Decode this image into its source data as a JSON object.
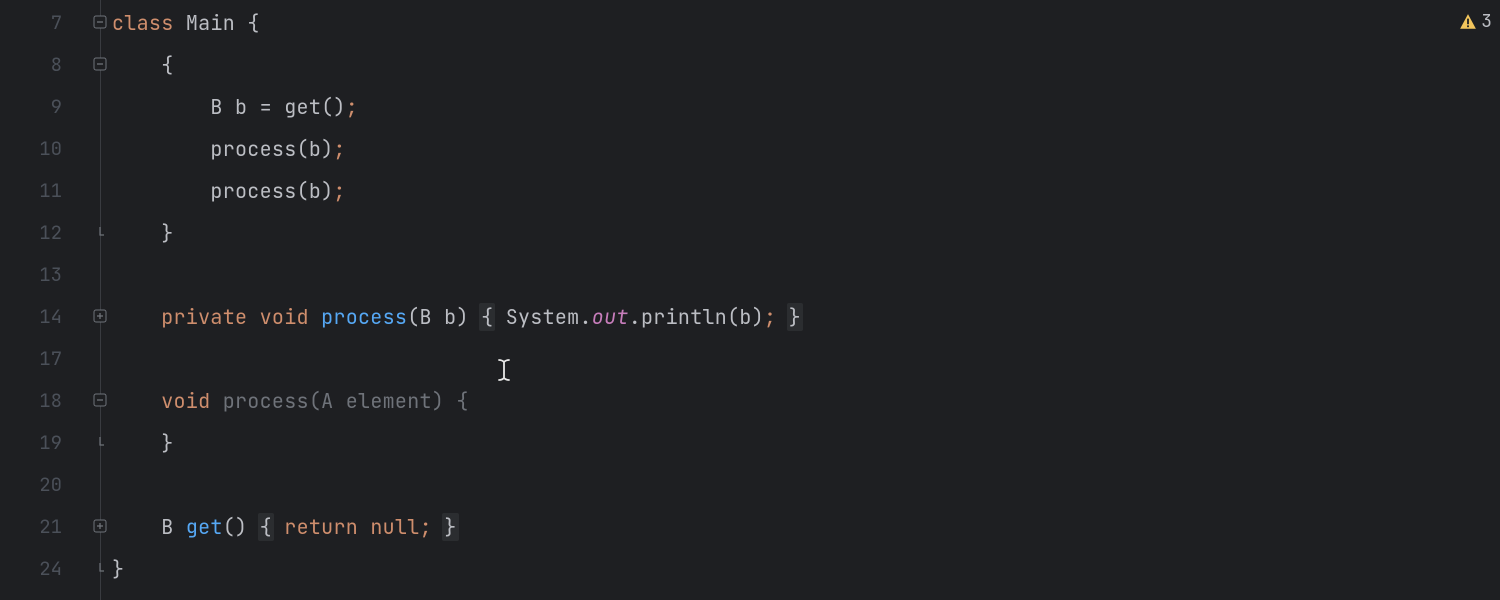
{
  "warningCount": "3",
  "lines": [
    {
      "num": "7",
      "fold": "minus-top",
      "tokens": [
        {
          "t": "class ",
          "c": "kw"
        },
        {
          "t": "Main ",
          "c": "name"
        },
        {
          "t": "{",
          "c": "paren"
        }
      ]
    },
    {
      "num": "8",
      "fold": "minus",
      "tokens": [
        {
          "t": "    {",
          "c": "paren"
        }
      ]
    },
    {
      "num": "9",
      "fold": "line",
      "tokens": [
        {
          "t": "        ",
          "c": ""
        },
        {
          "t": "B b ",
          "c": "name"
        },
        {
          "t": "= ",
          "c": "name"
        },
        {
          "t": "get",
          "c": "fn-call"
        },
        {
          "t": "()",
          "c": "paren"
        },
        {
          "t": ";",
          "c": "semi"
        }
      ]
    },
    {
      "num": "10",
      "fold": "line",
      "tokens": [
        {
          "t": "        ",
          "c": ""
        },
        {
          "t": "process",
          "c": "fn-call"
        },
        {
          "t": "(b)",
          "c": "paren"
        },
        {
          "t": ";",
          "c": "semi"
        }
      ]
    },
    {
      "num": "11",
      "fold": "line",
      "tokens": [
        {
          "t": "        ",
          "c": ""
        },
        {
          "t": "process",
          "c": "fn-call"
        },
        {
          "t": "(b)",
          "c": "paren"
        },
        {
          "t": ";",
          "c": "semi"
        }
      ]
    },
    {
      "num": "12",
      "fold": "close",
      "tokens": [
        {
          "t": "    }",
          "c": "paren"
        }
      ]
    },
    {
      "num": "13",
      "fold": "line",
      "tokens": []
    },
    {
      "num": "14",
      "fold": "plus",
      "tokens": [
        {
          "t": "    ",
          "c": ""
        },
        {
          "t": "private void ",
          "c": "kw"
        },
        {
          "t": "process",
          "c": "fn-def"
        },
        {
          "t": "(",
          "c": "paren"
        },
        {
          "t": "B b",
          "c": "param"
        },
        {
          "t": ")",
          "c": "paren"
        },
        {
          "t": " ",
          "c": ""
        },
        {
          "t": "{",
          "c": "paren",
          "hl": true
        },
        {
          "t": " ",
          "c": ""
        },
        {
          "t": "System.",
          "c": "name"
        },
        {
          "t": "out",
          "c": "static-field"
        },
        {
          "t": ".println(b)",
          "c": "name"
        },
        {
          "t": ";",
          "c": "semi"
        },
        {
          "t": " ",
          "c": ""
        },
        {
          "t": "}",
          "c": "paren",
          "hl": true
        }
      ]
    },
    {
      "num": "17",
      "fold": "line",
      "tokens": []
    },
    {
      "num": "18",
      "fold": "minus",
      "tokens": [
        {
          "t": "    ",
          "c": ""
        },
        {
          "t": "void ",
          "c": "kw"
        },
        {
          "t": "process",
          "c": "dim"
        },
        {
          "t": "(",
          "c": "dim"
        },
        {
          "t": "A element",
          "c": "dim"
        },
        {
          "t": ") {",
          "c": "dim"
        }
      ]
    },
    {
      "num": "19",
      "fold": "close",
      "tokens": [
        {
          "t": "    }",
          "c": "paren"
        }
      ]
    },
    {
      "num": "20",
      "fold": "line",
      "tokens": []
    },
    {
      "num": "21",
      "fold": "plus",
      "tokens": [
        {
          "t": "    ",
          "c": ""
        },
        {
          "t": "B ",
          "c": "type"
        },
        {
          "t": "get",
          "c": "fn-def"
        },
        {
          "t": "()",
          "c": "paren"
        },
        {
          "t": " ",
          "c": ""
        },
        {
          "t": "{",
          "c": "paren",
          "hl": true
        },
        {
          "t": " ",
          "c": ""
        },
        {
          "t": "return null",
          "c": "kw"
        },
        {
          "t": ";",
          "c": "semi"
        },
        {
          "t": " ",
          "c": ""
        },
        {
          "t": "}",
          "c": "paren",
          "hl": true
        }
      ]
    },
    {
      "num": "24",
      "fold": "close",
      "tokens": [
        {
          "t": "}",
          "c": "paren"
        }
      ]
    }
  ]
}
